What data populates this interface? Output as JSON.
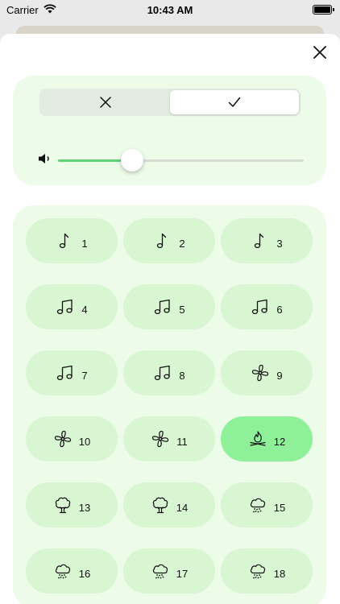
{
  "status_bar": {
    "carrier": "Carrier",
    "time": "10:43 AM"
  },
  "colors": {
    "accent": "#5fd37a",
    "panel": "#edfbe9",
    "button": "#d9f6d2",
    "active": "#8ef19a"
  },
  "segmented": {
    "options": [
      {
        "icon": "close-icon",
        "selected": false
      },
      {
        "icon": "checkmark-icon",
        "selected": true
      }
    ]
  },
  "volume": {
    "icon": "speaker-icon",
    "level": 0.3
  },
  "sounds": [
    {
      "label": "1",
      "icon": "music-note-icon",
      "active": false
    },
    {
      "label": "2",
      "icon": "music-note-icon",
      "active": false
    },
    {
      "label": "3",
      "icon": "music-note-icon",
      "active": false
    },
    {
      "label": "4",
      "icon": "music-notes-icon",
      "active": false
    },
    {
      "label": "5",
      "icon": "music-notes-icon",
      "active": false
    },
    {
      "label": "6",
      "icon": "music-notes-icon",
      "active": false
    },
    {
      "label": "7",
      "icon": "music-notes-icon",
      "active": false
    },
    {
      "label": "8",
      "icon": "music-notes-icon",
      "active": false
    },
    {
      "label": "9",
      "icon": "fan-icon",
      "active": false
    },
    {
      "label": "10",
      "icon": "fan-icon",
      "active": false
    },
    {
      "label": "11",
      "icon": "fan-icon",
      "active": false
    },
    {
      "label": "12",
      "icon": "campfire-icon",
      "active": true
    },
    {
      "label": "13",
      "icon": "tree-icon",
      "active": false
    },
    {
      "label": "14",
      "icon": "tree-icon",
      "active": false
    },
    {
      "label": "15",
      "icon": "rain-cloud-icon",
      "active": false
    },
    {
      "label": "16",
      "icon": "rain-cloud-icon",
      "active": false
    },
    {
      "label": "17",
      "icon": "rain-cloud-icon",
      "active": false
    },
    {
      "label": "18",
      "icon": "rain-cloud-icon",
      "active": false
    }
  ]
}
